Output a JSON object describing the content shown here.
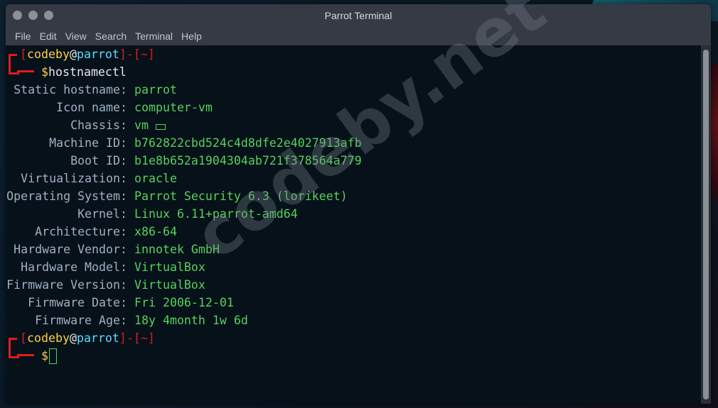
{
  "window": {
    "title": "Parrot Terminal"
  },
  "menu": [
    "File",
    "Edit",
    "View",
    "Search",
    "Terminal",
    "Help"
  ],
  "prompt": {
    "open_bracket": "[",
    "user": "codeby",
    "at": "@",
    "host": "parrot",
    "close_bracket": "]",
    "dash": "-",
    "dir_open": "[",
    "dir": "~",
    "dir_close": "]",
    "dollar": "$"
  },
  "command": "hostnamectl",
  "output": [
    {
      "label": "Static hostname:",
      "value": "parrot"
    },
    {
      "label": "Icon name:",
      "value": "computer-vm"
    },
    {
      "label": "Chassis:",
      "value": "vm"
    },
    {
      "label": "Machine ID:",
      "value": "b762822cbd524c4d8dfe2e4027913afb"
    },
    {
      "label": "Boot ID:",
      "value": "b1e8b652a1904304ab721f378564a779"
    },
    {
      "label": "Virtualization:",
      "value": "oracle"
    },
    {
      "label": "Operating System:",
      "value": "Parrot Security 6.3 (lorikeet)"
    },
    {
      "label": "Kernel:",
      "value": "Linux 6.11+parrot-amd64"
    },
    {
      "label": "Architecture:",
      "value": "x86-64"
    },
    {
      "label": "Hardware Vendor:",
      "value": "innotek GmbH"
    },
    {
      "label": "Hardware Model:",
      "value": "VirtualBox"
    },
    {
      "label": "Firmware Version:",
      "value": "VirtualBox"
    },
    {
      "label": "Firmware Date:",
      "value": "Fri 2006-12-01"
    },
    {
      "label": "Firmware Age:",
      "value": "18y 4month 1w 6d"
    }
  ],
  "watermark": "codeby.net",
  "colors": {
    "prompt_red": "#e11b1b",
    "value_green": "#59d15c",
    "label_grey": "#9fb1c1",
    "user_yellow": "#ffd23f",
    "terminal_bg": "#06111a",
    "titlebar_bg": "#353a44"
  }
}
